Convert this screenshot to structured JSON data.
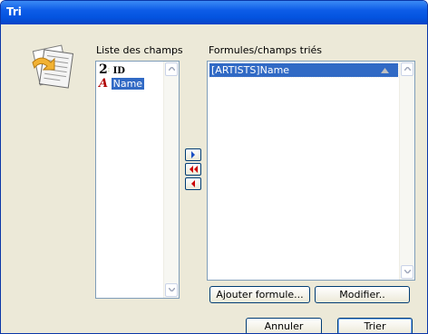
{
  "window": {
    "title": "Tri"
  },
  "fields": {
    "label": "Liste des champs",
    "items": [
      {
        "type_icon": "number-type-icon",
        "type_glyph": "2",
        "name": "ID"
      },
      {
        "type_icon": "text-type-icon",
        "type_glyph": "A",
        "name": "Name"
      }
    ]
  },
  "sorted": {
    "label": "Formules/champs triés",
    "items": [
      {
        "text": "[ARTISTS]Name",
        "order_icon": "ascending-order-icon"
      }
    ]
  },
  "actions": {
    "add_formula": "Ajouter formule...",
    "modify": "Modifier..",
    "cancel": "Annuler",
    "sort": "Trier"
  },
  "colors": {
    "titlebar": "#0454e0",
    "selection": "#316ac5",
    "order_arrow": "#cc0000",
    "dialog_bg": "#ece9d8"
  }
}
